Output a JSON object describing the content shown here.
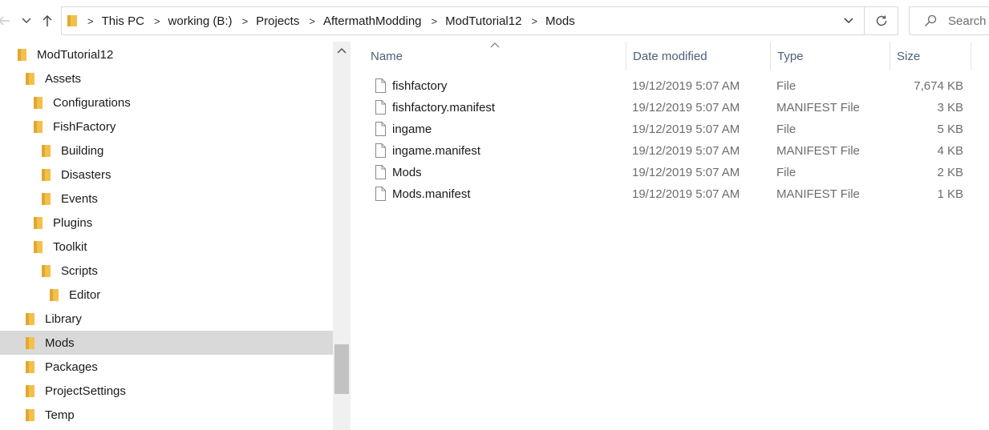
{
  "address_bar": {
    "breadcrumbs": [
      "This PC",
      "working (B:)",
      "Projects",
      "AftermathModding",
      "ModTutorial12",
      "Mods"
    ]
  },
  "search": {
    "placeholder": "Search"
  },
  "icons": {
    "back": "arrow-left-icon",
    "recent": "chevron-down-icon",
    "up": "arrow-up-icon",
    "folder": "folder-icon",
    "refresh": "refresh-icon",
    "search": "search-icon",
    "file": "file-icon"
  },
  "colors": {
    "folder": "#f4c04d",
    "selection": "#d9d9d9",
    "header_text": "#4c607a"
  },
  "nav_tree": [
    {
      "label": "ModTutorial12",
      "level": 0,
      "selected": false
    },
    {
      "label": "Assets",
      "level": 1,
      "selected": false
    },
    {
      "label": "Configurations",
      "level": 2,
      "selected": false
    },
    {
      "label": "FishFactory",
      "level": 2,
      "selected": false
    },
    {
      "label": "Building",
      "level": 3,
      "selected": false
    },
    {
      "label": "Disasters",
      "level": 3,
      "selected": false
    },
    {
      "label": "Events",
      "level": 3,
      "selected": false
    },
    {
      "label": "Plugins",
      "level": 2,
      "selected": false
    },
    {
      "label": "Toolkit",
      "level": 2,
      "selected": false
    },
    {
      "label": "Scripts",
      "level": 3,
      "selected": false
    },
    {
      "label": "Editor",
      "level": 4,
      "selected": false
    },
    {
      "label": "Library",
      "level": 1,
      "selected": false
    },
    {
      "label": "Mods",
      "level": 1,
      "selected": true
    },
    {
      "label": "Packages",
      "level": 1,
      "selected": false
    },
    {
      "label": "ProjectSettings",
      "level": 1,
      "selected": false
    },
    {
      "label": "Temp",
      "level": 1,
      "selected": false
    }
  ],
  "columns": {
    "name": "Name",
    "date": "Date modified",
    "type": "Type",
    "size": "Size"
  },
  "files": [
    {
      "name": "fishfactory",
      "date": "19/12/2019 5:07 AM",
      "type": "File",
      "size": "7,674 KB"
    },
    {
      "name": "fishfactory.manifest",
      "date": "19/12/2019 5:07 AM",
      "type": "MANIFEST File",
      "size": "3 KB"
    },
    {
      "name": "ingame",
      "date": "19/12/2019 5:07 AM",
      "type": "File",
      "size": "5 KB"
    },
    {
      "name": "ingame.manifest",
      "date": "19/12/2019 5:07 AM",
      "type": "MANIFEST File",
      "size": "4 KB"
    },
    {
      "name": "Mods",
      "date": "19/12/2019 5:07 AM",
      "type": "File",
      "size": "2 KB"
    },
    {
      "name": "Mods.manifest",
      "date": "19/12/2019 5:07 AM",
      "type": "MANIFEST File",
      "size": "1 KB"
    }
  ]
}
